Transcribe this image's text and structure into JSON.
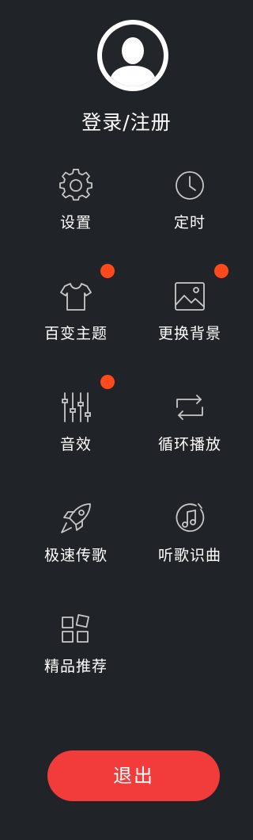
{
  "profile": {
    "login_label": "登录/注册"
  },
  "menu": {
    "items": [
      {
        "label": "设置",
        "icon": "gear-icon",
        "badge": false
      },
      {
        "label": "定时",
        "icon": "clock-icon",
        "badge": false
      },
      {
        "label": "百变主题",
        "icon": "shirt-icon",
        "badge": true
      },
      {
        "label": "更换背景",
        "icon": "image-icon",
        "badge": true
      },
      {
        "label": "音效",
        "icon": "equalizer-icon",
        "badge": true
      },
      {
        "label": "循环播放",
        "icon": "repeat-icon",
        "badge": false
      },
      {
        "label": "极速传歌",
        "icon": "rocket-icon",
        "badge": false
      },
      {
        "label": "听歌识曲",
        "icon": "music-note-icon",
        "badge": false
      },
      {
        "label": "精品推荐",
        "icon": "apps-grid-icon",
        "badge": false
      }
    ]
  },
  "logout": {
    "label": "退出"
  },
  "colors": {
    "background": "#202327",
    "accent": "#f23c3c",
    "badge": "#ff4a1c",
    "icon_stroke": "#c8c8c8"
  }
}
